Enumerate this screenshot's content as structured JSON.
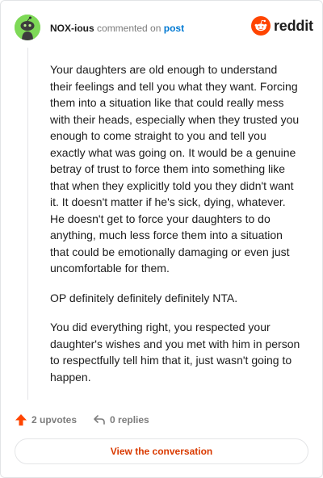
{
  "comment": {
    "author": "NOX-ious",
    "action_text": "commented on",
    "post_link": "post",
    "paragraphs": [
      "Your daughters are old enough to understand their feelings and tell you what they want. Forcing them into a situation like that could really mess with their heads, especially when they trusted you enough to come straight to you and tell you exactly what was going on. It would be a genuine betray of trust to force them into something like that when they explicitly told you they didn't want it. It doesn't matter if he's sick, dying, whatever. He doesn't get to force your daughters to do anything, much less force them into a situation that could be emotionally damaging or even just uncomfortable for them.",
      "OP definitely definitely definitely NTA.",
      "You did everything right, you respected your daughter's wishes and you met with him in person to respectfully tell him that it, just wasn't going to happen."
    ]
  },
  "brand": {
    "name": "reddit",
    "color": "#ff4500"
  },
  "actions": {
    "upvotes": "2 upvotes",
    "replies": "0 replies"
  },
  "footer": {
    "button_label": "View the conversation"
  },
  "colors": {
    "avatar_bg": "#7ed957",
    "link_blue": "#0079d3",
    "upvote_orange": "#ff4500",
    "button_text": "#d93a00"
  }
}
